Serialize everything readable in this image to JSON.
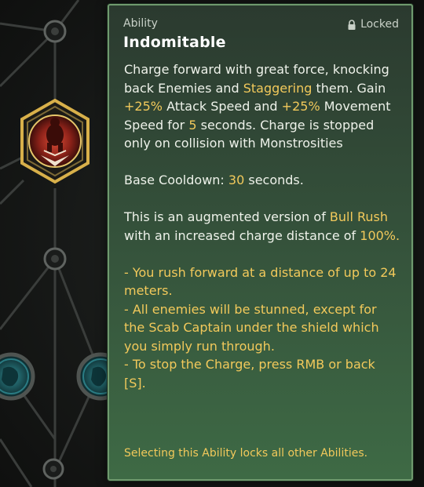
{
  "tooltip": {
    "category": "Ability",
    "locked_label": "Locked",
    "title": "Indomitable",
    "desc_1": "Charge forward with great force, knocking back Enemies and",
    "desc_stagger": "Staggering",
    "desc_2": "them. Gain",
    "desc_attack_pct": "+25%",
    "desc_3": "Attack Speed and",
    "desc_move_pct": "+25%",
    "desc_4": "Movement Speed for",
    "desc_seconds": "5",
    "desc_5": "seconds. Charge is stopped only on collision with Monstrosities",
    "cooldown_label": "Base Cooldown:",
    "cooldown_value": "30",
    "cooldown_unit": "seconds.",
    "aug_1": "This is an augmented version of",
    "aug_ability": "Bull Rush",
    "aug_2": "with an increased charge distance of",
    "aug_pct": "100%.",
    "bullet_1": "- You rush forward at a distance of up to 24 meters.",
    "bullet_2": "- All enemies will be stunned, except for the Scab Captain under the shield which you simply run through.",
    "bullet_3": "- To stop the Charge, press RMB or back [S].",
    "footer": "Selecting this Ability locks all other Abilities."
  },
  "colors": {
    "highlight": "#f2c95b",
    "panel_border": "#6f9a6e",
    "node_gold": "#d8b04a",
    "node_cyan": "#3aa9b3"
  },
  "tree": {
    "selected_node_icon": "charging-brute-icon",
    "other_node_icon": "creature-icon"
  }
}
